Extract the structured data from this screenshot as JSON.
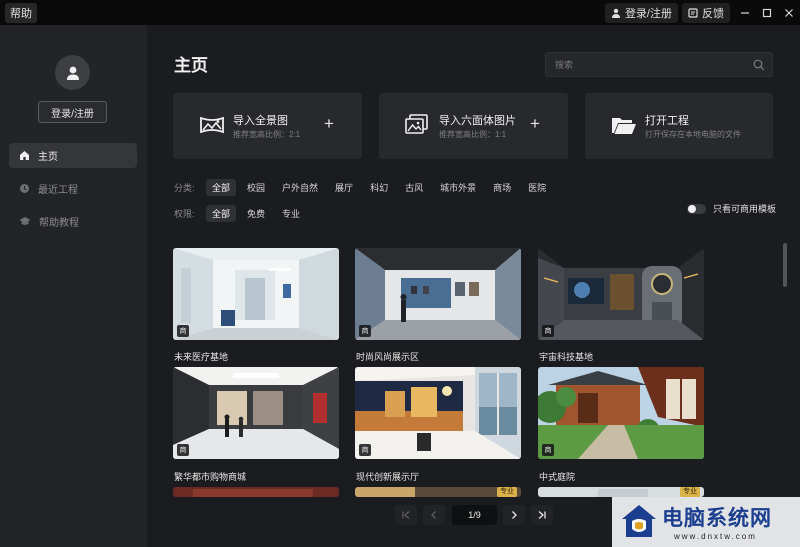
{
  "titlebar": {
    "help": "帮助",
    "login": "登录/注册",
    "feedback": "反馈",
    "icons": [
      "user-icon",
      "feedback-icon",
      "minimize-icon",
      "maximize-icon",
      "close-icon"
    ]
  },
  "sidebar": {
    "login_button": "登录/注册",
    "items": [
      {
        "label": "主页",
        "icon": "home-icon",
        "active": true
      },
      {
        "label": "最近工程",
        "icon": "clock-icon",
        "active": false
      },
      {
        "label": "帮助教程",
        "icon": "graduation-cap-icon",
        "active": false
      }
    ]
  },
  "main": {
    "title": "主页",
    "search": {
      "placeholder": "搜索",
      "value": ""
    },
    "actions": [
      {
        "title": "导入全景图",
        "subtitle": "推荐宽高比例：2:1",
        "icon": "panorama-icon",
        "has_plus": true
      },
      {
        "title": "导入六面体图片",
        "subtitle": "推荐宽高比例：1:1",
        "icon": "images-icon",
        "has_plus": true
      },
      {
        "title": "打开工程",
        "subtitle": "打开保存在本地电脑的文件",
        "icon": "folder-icon",
        "has_plus": false
      }
    ],
    "category": {
      "label": "分类:",
      "options": [
        "全部",
        "校园",
        "户外自然",
        "展厅",
        "科幻",
        "古风",
        "城市外景",
        "商场",
        "医院"
      ],
      "selected": "全部"
    },
    "permission": {
      "label": "权限:",
      "options": [
        "全部",
        "免费",
        "专业"
      ],
      "selected": "全部"
    },
    "commercial_toggle": {
      "label": "只看可商用模板",
      "on": false
    },
    "templates": [
      {
        "title": "未来医疗基地",
        "badge": "商"
      },
      {
        "title": "时尚风尚展示区",
        "badge": "商"
      },
      {
        "title": "宇宙科技基地",
        "badge": "商"
      },
      {
        "title": "繁华都市购物商城",
        "badge": "商"
      },
      {
        "title": "现代创新展示厅",
        "badge": "商"
      },
      {
        "title": "中式庭院",
        "badge": "商"
      }
    ],
    "partial_row_badges": [
      "专业",
      "专业"
    ],
    "pagination": {
      "current": "1/9"
    }
  },
  "watermark": {
    "main": "电脑系统网",
    "sub": "www.dnxtw.com"
  }
}
